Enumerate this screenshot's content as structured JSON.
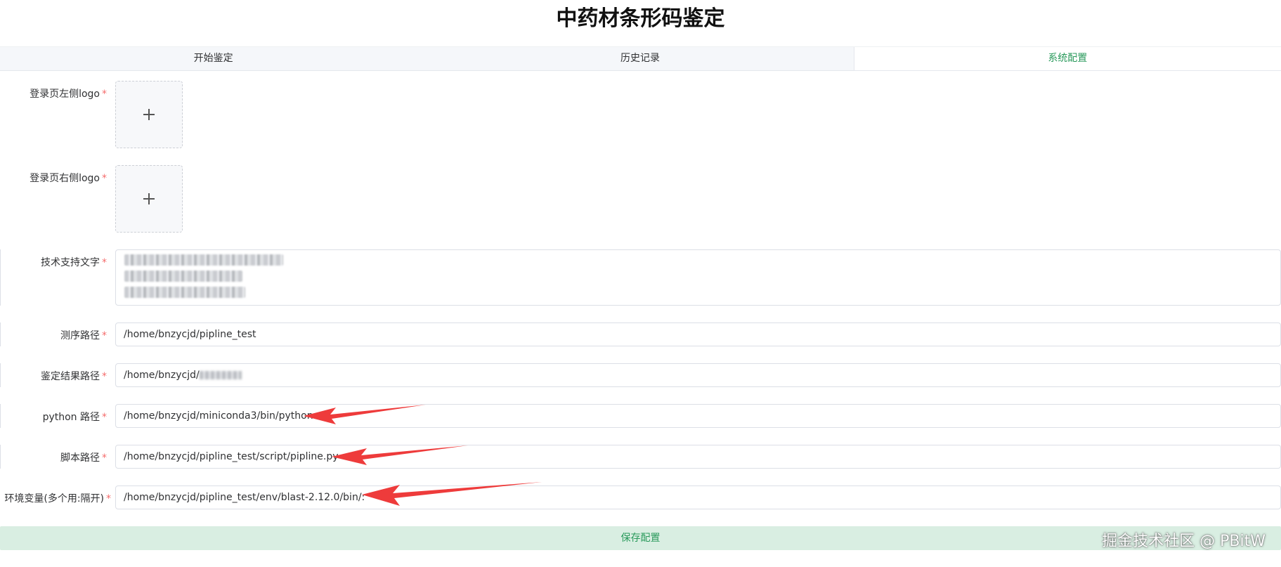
{
  "title": "中药材条形码鉴定",
  "tabs": [
    {
      "label": "开始鉴定"
    },
    {
      "label": "历史记录"
    },
    {
      "label": "系统配置"
    }
  ],
  "active_tab": "系统配置",
  "form": {
    "left_logo_label": "登录页左侧logo",
    "right_logo_label": "登录页右侧logo",
    "support_text_label": "技术支持文字",
    "sequence_path_label": "测序路径",
    "sequence_path_value": "/home/bnzycjd/pipline_test",
    "result_path_label": "鉴定结果路径",
    "result_path_value": "/home/bnzycjd/",
    "python_path_label": "python 路径",
    "python_path_value": "/home/bnzycjd/miniconda3/bin/python",
    "script_path_label": "脚本路径",
    "script_path_value": "/home/bnzycjd/pipline_test/script/pipline.py",
    "env_label": "环境变量(多个用:隔开)",
    "env_value": "/home/bnzycjd/pipline_test/env/blast-2.12.0/bin/:",
    "required_mark": "*"
  },
  "save_label": "保存配置",
  "watermark": "掘金技术社区 @ PBitW",
  "colors": {
    "accent": "#2a9a5c",
    "required": "#f56c6c",
    "arrow": "#ee3b3b",
    "save_bg": "#d9eee2"
  },
  "icons": [
    "plus-icon",
    "arrow-annotation"
  ]
}
